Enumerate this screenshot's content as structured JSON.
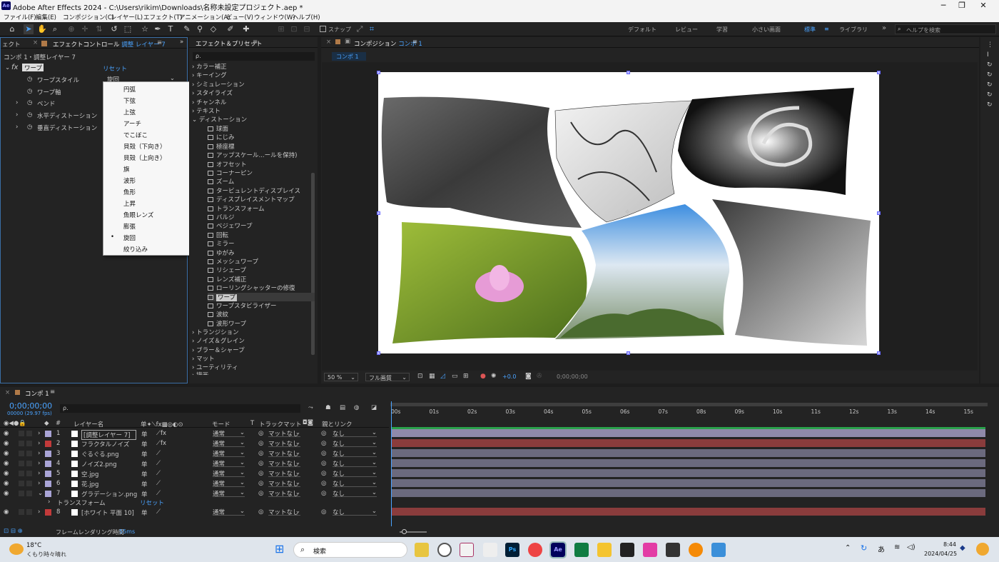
{
  "window": {
    "title": "Adobe After Effects 2024 - C:\\Users\\rikim\\Downloads\\名称未設定プロジェクト.aep *",
    "app_badge": "Ae",
    "minimize": "─",
    "maximize": "❐",
    "close": "✕"
  },
  "menu": [
    "ファイル(F)",
    "編集(E)",
    "コンポジション(C)",
    "レイヤー(L)",
    "エフェクト(T)",
    "アニメーション(A)",
    "ビュー(V)",
    "ウィンドウ(W)",
    "ヘルプ(H)"
  ],
  "toolbar": {
    "snap_label": "スナップ",
    "workspaces": [
      "デフォルト",
      "レビュー",
      "学習",
      "小さい画面",
      "標準",
      "ライブラリ"
    ],
    "active_workspace": "標準",
    "overflow": "»",
    "help_placeholder": "ヘルプを検索"
  },
  "effect_controls": {
    "tab_prefix": "ェクト",
    "tab_title": "エフェクトコントロール",
    "tab_layer": "調整 レイヤー 7",
    "breadcrumb": "コンポ 1・調整レイヤー 7",
    "effect_name": "ワープ",
    "reset": "リセット",
    "fx": "fx",
    "params": [
      {
        "label": "ワープスタイル",
        "value": "旋回"
      },
      {
        "label": "ワープ軸",
        "value": ""
      },
      {
        "label": "ベンド",
        "value": ""
      },
      {
        "label": "水平ディストーション",
        "value": ""
      },
      {
        "label": "垂直ディストーション",
        "value": ""
      }
    ]
  },
  "warp_style_menu": {
    "items": [
      "円弧",
      "下弦",
      "上弦",
      "アーチ",
      "でこぼこ",
      "貝殻（下向き）",
      "貝殻（上向き）",
      "旗",
      "波形",
      "魚形",
      "上昇",
      "魚眼レンズ",
      "膨張",
      "旋回",
      "絞り込み"
    ],
    "selected": "旋回"
  },
  "effects_presets": {
    "title": "エフェクト＆プリセット",
    "search_placeholder": "ρ.",
    "categories_top": [
      "カラー補正",
      "キーイング",
      "シミュレーション",
      "スタイライズ",
      "チャンネル",
      "テキスト",
      "ディストーション"
    ],
    "distortion_items": [
      "球面",
      "にじみ",
      "極座標",
      "アップスケール...ールを保持)",
      "オフセット",
      "コーナーピン",
      "ズーム",
      "タービュレントディスプレイス",
      "ディスプレイスメントマップ",
      "トランスフォーム",
      "バルジ",
      "ベジェワープ",
      "回転",
      "ミラー",
      "ゆがみ",
      "メッシュワープ",
      "リシェープ",
      "レンズ補正",
      "ローリングシャッターの修復",
      "ワープ",
      "ワープスタビライザー",
      "波紋",
      "波形ワープ"
    ],
    "selected": "ワープ",
    "categories_bottom": [
      "トランジション",
      "ノイズ＆グレイン",
      "ブラー＆シャープ",
      "マット",
      "ユーティリティ",
      "描画"
    ]
  },
  "composition": {
    "tab_label": "コンポジション",
    "tab_name": "コンポ 1",
    "subtab": "コンポ 1",
    "zoom": "50 %",
    "quality": "フル画質",
    "exposure": "+0.0",
    "timecode": "0;00;00;00"
  },
  "timeline": {
    "tab": "コンポ 1",
    "timecode": "0;00;00;00",
    "fps": "00000 (29.97 fps)",
    "search_placeholder": "ρ.",
    "headers": {
      "num": "#",
      "layer_name": "レイヤー名",
      "mode": "モード",
      "t": "T",
      "track_matte": "トラックマット",
      "parent": "親とリンク"
    },
    "ruler": [
      "00s",
      "01s",
      "02s",
      "03s",
      "04s",
      "05s",
      "06s",
      "07s",
      "08s",
      "09s",
      "10s",
      "11s",
      "12s",
      "13s",
      "14s",
      "15s"
    ],
    "layers": [
      {
        "num": "1",
        "name": "[調整レイヤー 7]",
        "color": "#a9a4d6",
        "mode": "通常",
        "matte": "マットなし",
        "parent": "なし",
        "bar": "#8f8aaa"
      },
      {
        "num": "2",
        "name": "フラクタルノイズ",
        "color": "#c23a3a",
        "mode": "通常",
        "matte": "マットなし",
        "parent": "なし",
        "bar": "#8a3c3c"
      },
      {
        "num": "3",
        "name": "ぐるぐる.png",
        "color": "#a9a4d6",
        "mode": "通常",
        "matte": "マットなし",
        "parent": "なし",
        "bar": "#6b6a7e"
      },
      {
        "num": "4",
        "name": "ノイズ2.png",
        "color": "#a9a4d6",
        "mode": "通常",
        "matte": "マットなし",
        "parent": "なし",
        "bar": "#6b6a7e"
      },
      {
        "num": "5",
        "name": "空.jpg",
        "color": "#a9a4d6",
        "mode": "通常",
        "matte": "マットなし",
        "parent": "なし",
        "bar": "#6b6a7e"
      },
      {
        "num": "6",
        "name": "花.jpg",
        "color": "#a9a4d6",
        "mode": "通常",
        "matte": "マットなし",
        "parent": "なし",
        "bar": "#6b6a7e"
      },
      {
        "num": "7",
        "name": "グラデーション.png",
        "color": "#a9a4d6",
        "mode": "通常",
        "matte": "マットなし",
        "parent": "なし",
        "bar": "#6b6a7e"
      },
      {
        "num": "8",
        "name": "[ホワイト 平面 10]",
        "color": "#c23a3a",
        "mode": "通常",
        "matte": "マットなし",
        "parent": "なし",
        "bar": "#8a3c3c"
      }
    ],
    "transform_label": "トランスフォーム",
    "transform_reset": "リセット",
    "footer": {
      "render_label": "フレームレンダリング時間",
      "render_time": "55ms"
    }
  },
  "taskbar": {
    "weather_temp": "18°C",
    "weather_desc": "くもり時々晴れ",
    "search": "検索",
    "time": "8:44",
    "date": "2024/04/25",
    "ime": "あ",
    "ps": "Ps",
    "ae": "Ae"
  }
}
